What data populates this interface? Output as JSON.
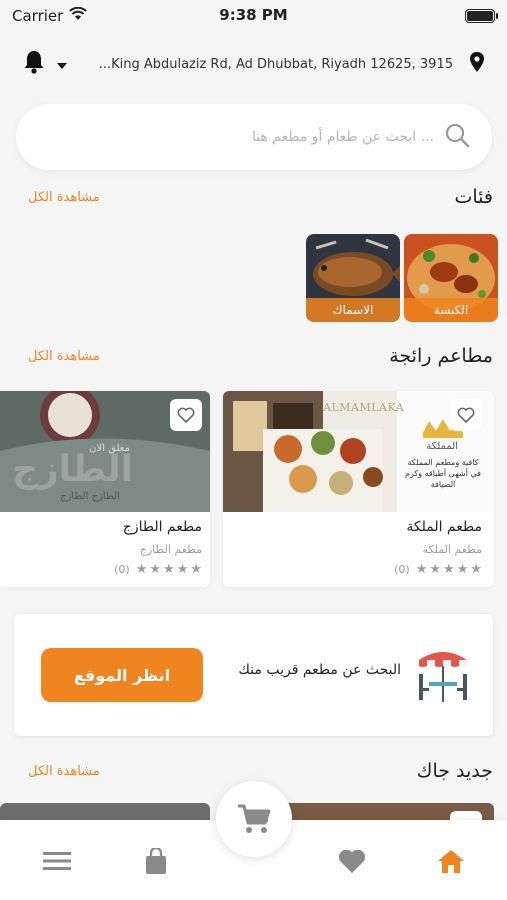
{
  "status": {
    "carrier": "Carrier",
    "time": "9:38 PM"
  },
  "address": {
    "text": "...King Abdulaziz Rd, Ad Dhubbat, Riyadh 12625,  3915"
  },
  "search": {
    "placeholder": "ابحث عن طعام أو مطعم هنا ..."
  },
  "categories": {
    "title": "فئات",
    "see_all": "مشاهدة الكل",
    "items": [
      {
        "label": "الكبسة",
        "icon": "kabsa-image"
      },
      {
        "label": "الاسماك",
        "icon": "fish-image"
      }
    ]
  },
  "featured": {
    "title": "مطاعم رائجة",
    "see_all": "مشاهدة الكل",
    "restaurants": [
      {
        "name": "مطعم الملكة",
        "subtitle": "مطعم الملكة",
        "rating_count": "(0)",
        "stars": 0,
        "logo_text": "ALMAMLAKA",
        "logo_ar": "المملكة",
        "tagline": "كافية ومطعم المملكة في أشهى أطباقه وكرم الضيافة"
      },
      {
        "name": "مطعم الطازج",
        "subtitle": "مطعم الطازج",
        "rating_count": "(0)",
        "stars": 0,
        "closed_badge": "مغلق الان",
        "logo_ar": "الطازج",
        "tagline": "الطازج الطازج"
      }
    ]
  },
  "nearby": {
    "text": "البحث عن مطعم قريب منك",
    "button": "انظر الموقع"
  },
  "new_for_you": {
    "title": "جديد جاك",
    "see_all": "مشاهدة الكل"
  },
  "nav": {
    "items": [
      "menu-icon",
      "bag-icon",
      "heart-icon",
      "home-icon"
    ],
    "active": "home-icon",
    "cart": "cart-icon"
  },
  "colors": {
    "accent": "#f0841e",
    "background": "#f5f5f5"
  }
}
